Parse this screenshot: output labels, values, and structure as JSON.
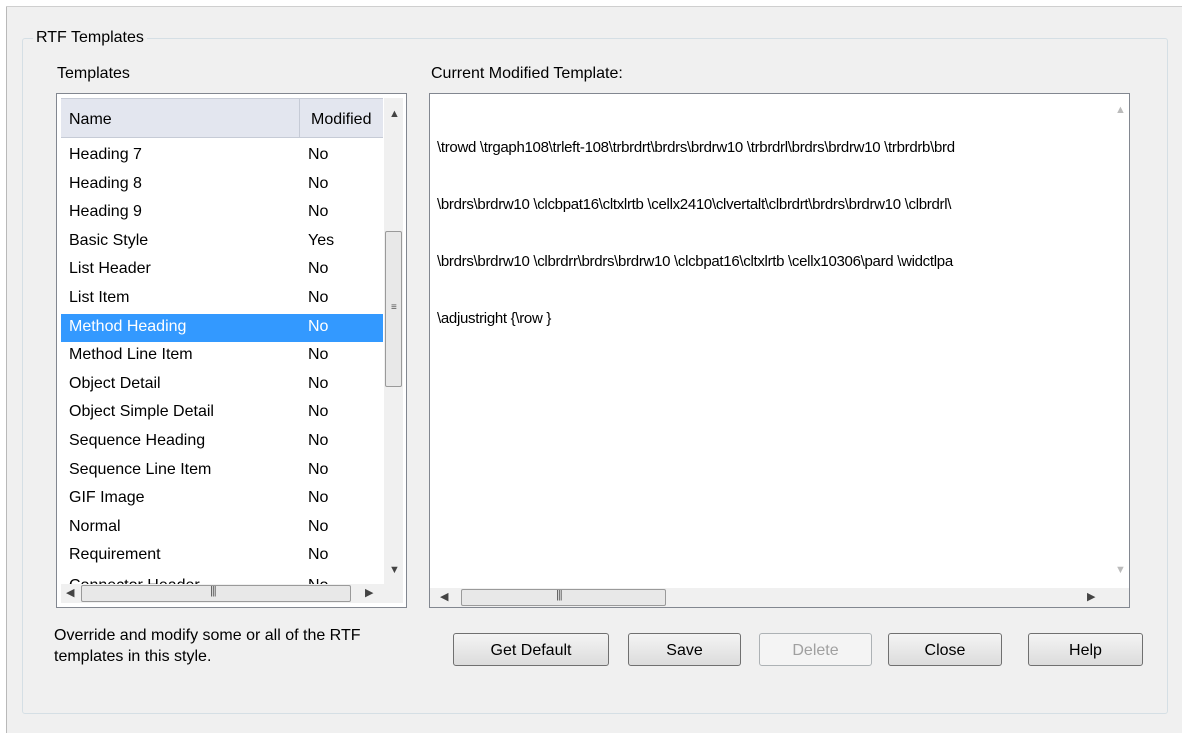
{
  "group": {
    "title": "RTF Templates"
  },
  "templates": {
    "label": "Templates",
    "columns": {
      "name": "Name",
      "modified": "Modified"
    },
    "rows": [
      {
        "name": "Heading 7",
        "modified": "No"
      },
      {
        "name": "Heading 8",
        "modified": "No"
      },
      {
        "name": "Heading 9",
        "modified": "No"
      },
      {
        "name": "Basic Style",
        "modified": "Yes"
      },
      {
        "name": "List Header",
        "modified": "No"
      },
      {
        "name": "List Item",
        "modified": "No"
      },
      {
        "name": "Method Heading",
        "modified": "No",
        "selected": true
      },
      {
        "name": "Method Line Item",
        "modified": "No"
      },
      {
        "name": "Object Detail",
        "modified": "No"
      },
      {
        "name": "Object Simple Detail",
        "modified": "No"
      },
      {
        "name": "Sequence Heading",
        "modified": "No"
      },
      {
        "name": "Sequence Line Item",
        "modified": "No"
      },
      {
        "name": "GIF Image",
        "modified": "No"
      },
      {
        "name": "Normal",
        "modified": "No"
      },
      {
        "name": "Requirement",
        "modified": "No"
      },
      {
        "name": "Connector Header",
        "modified": "No"
      }
    ]
  },
  "editor": {
    "label": "Current Modified Template:",
    "lines": [
      "\\trowd \\trgaph108\\trleft-108\\trbrdrt\\brdrs\\brdrw10 \\trbrdrl\\brdrs\\brdrw10 \\trbrdrb\\brd",
      "\\brdrs\\brdrw10 \\clcbpat16\\cltxlrtb \\cellx2410\\clvertalt\\clbrdrt\\brdrs\\brdrw10 \\clbrdrl\\",
      "\\brdrs\\brdrw10 \\clbrdrr\\brdrs\\brdrw10 \\clcbpat16\\cltxlrtb \\cellx10306\\pard \\widctlpa",
      "\\adjustright {\\row }"
    ]
  },
  "description": "Override and modify some or all of the RTF templates in this style.",
  "buttons": {
    "get_default": "Get Default",
    "save": "Save",
    "delete": "Delete",
    "close": "Close",
    "help": "Help"
  },
  "icons": {
    "scroll_up": "up-arrow-icon",
    "scroll_down": "down-arrow-icon",
    "scroll_left": "left-arrow-icon",
    "scroll_right": "right-arrow-icon",
    "grip": "scroll-grip-icon"
  },
  "colors": {
    "selection": "#3399ff",
    "header": "#e3e6ef",
    "background": "#f0f0f0"
  }
}
